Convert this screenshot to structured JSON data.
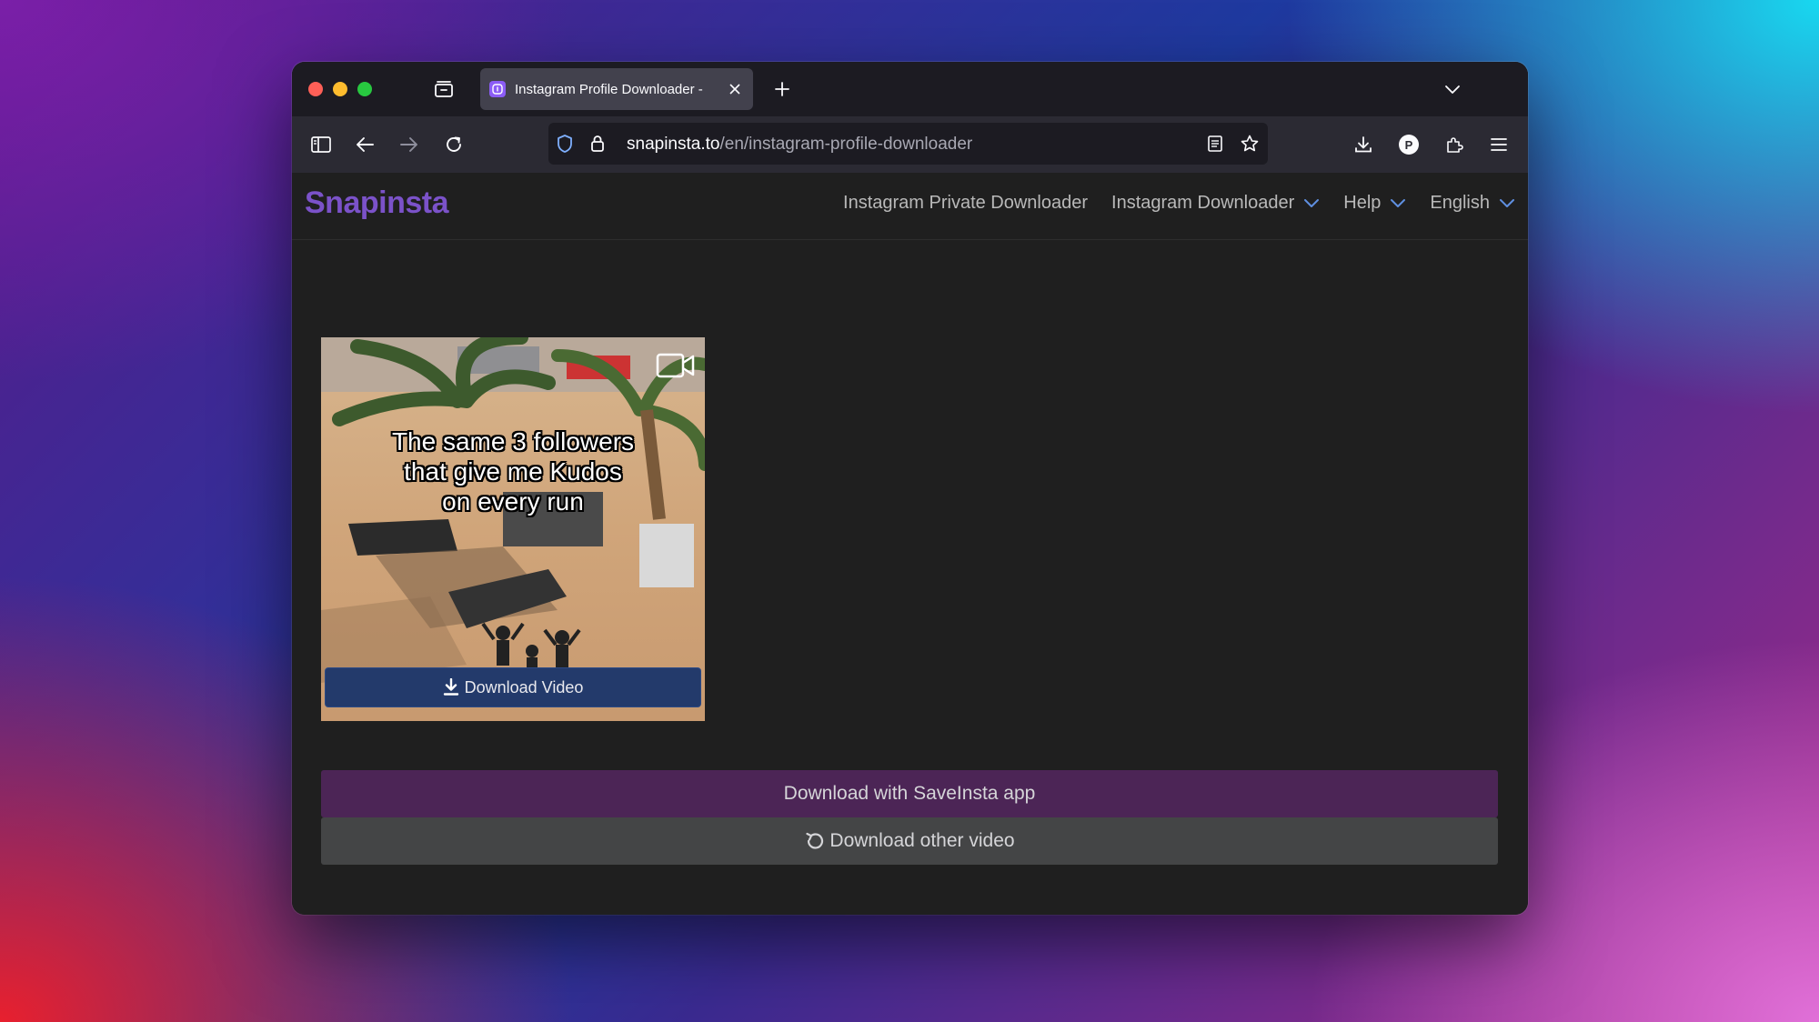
{
  "browser": {
    "tab_title": "Instagram Profile Downloader - ",
    "url_domain": "snapinsta.to",
    "url_path": "/en/instagram-profile-downloader",
    "profile_initial": "P"
  },
  "site": {
    "logo": "Snapinsta",
    "nav": [
      {
        "label": "Instagram Private Downloader"
      },
      {
        "label": "Instagram Downloader"
      },
      {
        "label": "Help"
      },
      {
        "label": "English"
      }
    ]
  },
  "media": {
    "caption_lines": [
      "The same 3 followers",
      "that give me Kudos",
      "on every run"
    ],
    "download_label": "Download Video"
  },
  "actions": {
    "app_label": "Download with SaveInsta app",
    "other_label": "Download other video"
  },
  "colors": {
    "accent": "#7b52c9",
    "download_button": "#233a6b",
    "app_button": "#4c2556",
    "other_button": "#444546"
  }
}
